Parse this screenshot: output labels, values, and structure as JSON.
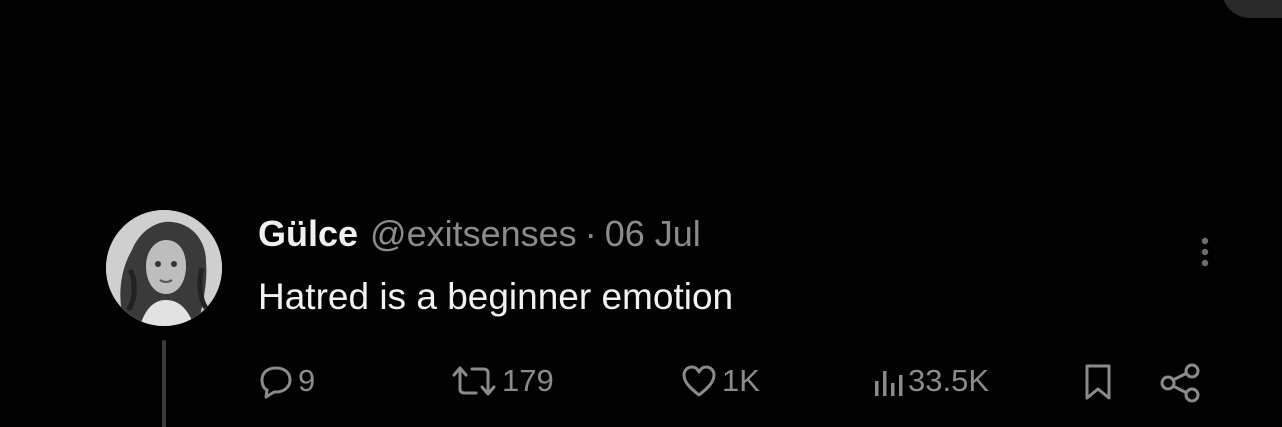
{
  "tweet": {
    "display_name": "Gülce",
    "handle": "@exitsenses",
    "separator": "·",
    "date": "06 Jul",
    "text": "Hatred is a beginner emotion"
  },
  "actions": {
    "replies": "9",
    "retweets": "179",
    "likes": "1K",
    "views": "33.5K"
  },
  "icons": {
    "reply": "speech-bubble-icon",
    "retweet": "retweet-arrows-icon",
    "like": "heart-icon",
    "views": "bar-chart-icon",
    "bookmark": "bookmark-icon",
    "share": "share-nodes-icon",
    "more": "vertical-dots-icon"
  },
  "colors": {
    "background": "#020202",
    "primary_text": "#f2f2f2",
    "secondary_text": "#8b8b8b"
  }
}
